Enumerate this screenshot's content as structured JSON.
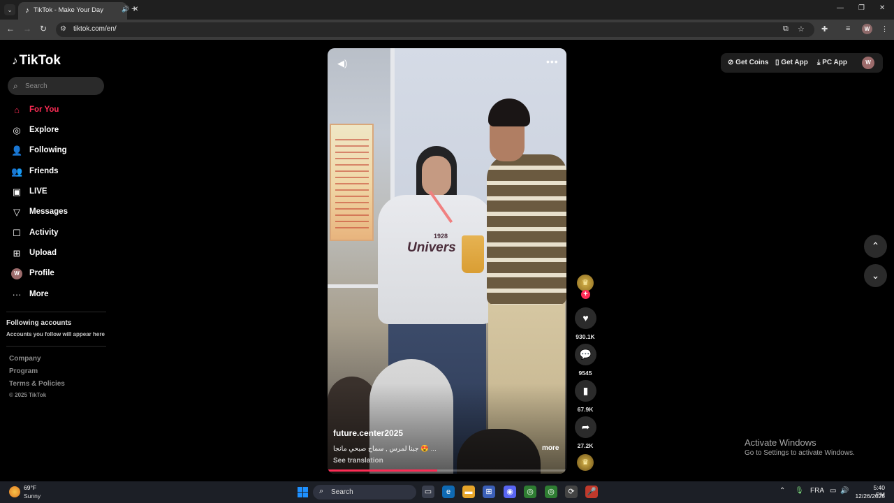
{
  "browser": {
    "tab_title": "TikTok - Make Your Day",
    "url": "tiktok.com/en/",
    "profile_initial": "W"
  },
  "sidebar": {
    "logo": "TikTok",
    "search_placeholder": "Search",
    "items": [
      {
        "label": "For You",
        "icon": "home-icon",
        "active": true
      },
      {
        "label": "Explore",
        "icon": "compass-icon"
      },
      {
        "label": "Following",
        "icon": "following-icon"
      },
      {
        "label": "Friends",
        "icon": "friends-icon"
      },
      {
        "label": "LIVE",
        "icon": "live-icon"
      },
      {
        "label": "Messages",
        "icon": "messages-icon"
      },
      {
        "label": "Activity",
        "icon": "activity-icon"
      },
      {
        "label": "Upload",
        "icon": "upload-icon"
      },
      {
        "label": "Profile",
        "icon": "avatar",
        "initial": "W"
      },
      {
        "label": "More",
        "icon": "more-icon"
      }
    ],
    "following_title": "Following accounts",
    "following_sub": "Accounts you follow will appear here",
    "footer_links": [
      "Company",
      "Program",
      "Terms & Policies"
    ],
    "copyright": "© 2025 TikTok"
  },
  "video": {
    "author": "future.center2025",
    "caption": "جبنا لمرس , سماح صبحي مانجا 😍 ...",
    "caption_more": "more",
    "see_translation": "See translation",
    "poster_text": "اللغة العربية",
    "shirt_number": "1928",
    "shirt_text": "Univers",
    "progress_fraction": 0.46
  },
  "actions": {
    "likes": "930.1K",
    "comments": "9545",
    "saves": "67.9K",
    "shares": "27.2K"
  },
  "topbar": {
    "get_coins": "Get Coins",
    "get_app": "Get App",
    "pc_app": "PC App",
    "avatar_initial": "W"
  },
  "activate_windows": {
    "title": "Activate Windows",
    "sub": "Go to Settings to activate Windows."
  },
  "taskbar": {
    "temperature": "69°F",
    "weather": "Sunny",
    "search_label": "Search",
    "language": "FRA",
    "time": "5:40 PM",
    "date": "12/26/2025"
  },
  "colors": {
    "accent": "#fe2c55",
    "background": "#000000"
  }
}
